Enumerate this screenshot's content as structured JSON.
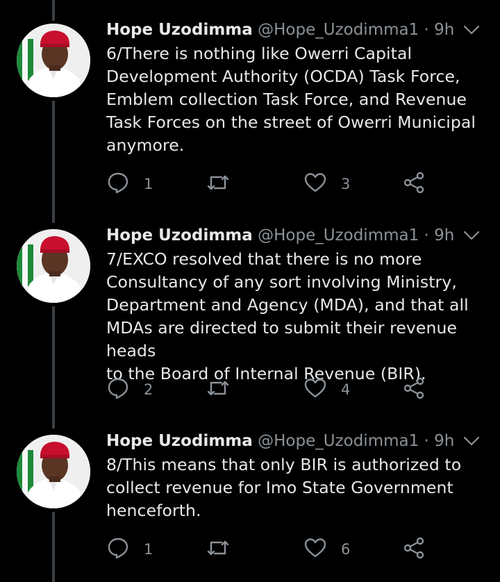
{
  "tweets": [
    {
      "name": "Hope Uzodimma",
      "handle": "@Hope_Uzodimma1",
      "time": "9h",
      "text": "6/There is nothing like Owerri Capital\nDevelopment Authority (OCDA) Task Force,\nEmblem collection Task Force, and Revenue\nTask Forces on the street of Owerri Municipal\nanymore.",
      "replies": "1",
      "retweets": "",
      "likes": "3"
    },
    {
      "name": "Hope Uzodimma",
      "handle": "@Hope_Uzodimma1",
      "time": "9h",
      "text": "7/EXCO resolved that there is no more\nConsultancy of any sort involving Ministry,\nDepartment and Agency (MDA), and that all\nMDAs are directed to submit their revenue heads\nto the Board of Internal Revenue (BIR).",
      "replies": "2",
      "retweets": "",
      "likes": "4"
    },
    {
      "name": "Hope Uzodimma",
      "handle": "@Hope_Uzodimma1",
      "time": "9h",
      "text": "8/This means that only BIR is authorized to\ncollect revenue for Imo State Government\nhenceforth.",
      "replies": "1",
      "retweets": "",
      "likes": "6"
    }
  ],
  "separator": "·",
  "icons": [
    "reply-icon",
    "retweet-icon",
    "like-icon",
    "share-icon",
    "chevron-down-icon"
  ],
  "colors": {
    "background": "#000000",
    "text": "#e7e9ea",
    "muted": "#8b9298",
    "thread_line": "#3a3f44"
  }
}
